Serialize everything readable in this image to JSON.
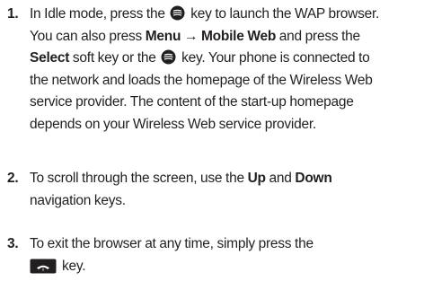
{
  "steps": [
    {
      "number": "1.",
      "line1_a": "In Idle mode, press the ",
      "line1_b": " key to launch the WAP browser.",
      "line2_a": "You can also press ",
      "menu": "Menu",
      "arrow": "→",
      "mobile_web": "Mobile Web",
      "line2_b": " and press the",
      "select": "Select",
      "line3_a": " soft key or the ",
      "line3_b": " key. Your phone is connected to",
      "line4": "the network and loads the homepage of the Wireless Web",
      "line5": "service provider. The content of the start-up homepage",
      "line6": "depends on your Wireless Web service provider."
    },
    {
      "number": "2.",
      "line1_a": "To scroll through the screen, use the ",
      "up": "Up",
      "and": " and ",
      "down": "Down",
      "line2": "navigation keys."
    },
    {
      "number": "3.",
      "line1": "To exit the browser at any time, simply press the",
      "line2": "key."
    }
  ],
  "icons": {
    "nav_key": "center-navigation-key-icon",
    "end_key": "end-key-icon"
  },
  "colors": {
    "text": "#231f20",
    "icon_dark": "#231f20",
    "icon_light": "#ffffff"
  }
}
